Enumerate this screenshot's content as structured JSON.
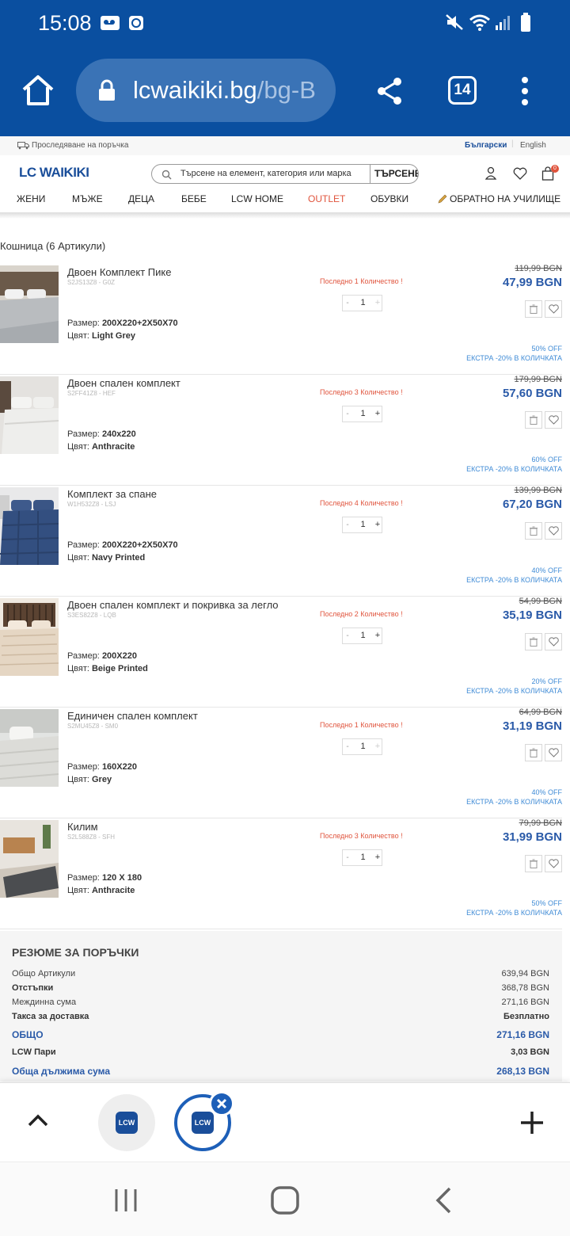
{
  "status_bar": {
    "time": "15:08"
  },
  "browser": {
    "url_host": "lcwaikiki.bg",
    "url_path": "/bg-B",
    "tab_count": "14"
  },
  "site_header": {
    "order_tracking": "Проследяване на поръчка",
    "lang_bg": "Български",
    "lang_en": "English",
    "logo": "LC WAIKIKI",
    "search_placeholder": "Търсене на елемент, категория или марка",
    "search_button": "ТЪРСЕНЕ",
    "cart_badge": "0",
    "nav": [
      "ЖЕНИ",
      "МЪЖЕ",
      "ДЕЦА",
      "БЕБЕ",
      "LCW HOME",
      "OUTLET",
      "ОБУВКИ",
      "ОБРАТНО НА УЧИЛИЩЕ"
    ]
  },
  "cart": {
    "title": "Кошница (6 Артикули)",
    "size_label": "Размер:",
    "color_label": "Цвят:",
    "items": [
      {
        "name": "Двоен Комплект Пике",
        "sku": "S2JS13Z8 - G0Z",
        "size": "200X220+2X50X70",
        "color": "Light Grey",
        "stock_note": "Последно 1 Количество !",
        "qty": "1",
        "old_price": "119,99 BGN",
        "price": "47,99 BGN",
        "discount": "50% OFF",
        "extra": "ЕКСТРА -20% В КОЛИЧКАТА"
      },
      {
        "name": "Двоен спален комплект",
        "sku": "S2FF41Z8 - HEF",
        "size": "240x220",
        "color": "Anthracite",
        "stock_note": "Последно 3 Количество !",
        "qty": "1",
        "old_price": "179,99 BGN",
        "price": "57,60 BGN",
        "discount": "60% OFF",
        "extra": "ЕКСТРА -20% В КОЛИЧКАТА"
      },
      {
        "name": "Комплект за спане",
        "sku": "W1H532Z8 - LSJ",
        "size": "200X220+2X50X70",
        "color": "Navy Printed",
        "stock_note": "Последно 4 Количество !",
        "qty": "1",
        "old_price": "139,99 BGN",
        "price": "67,20 BGN",
        "discount": "40% OFF",
        "extra": "ЕКСТРА -20% В КОЛИЧКАТА"
      },
      {
        "name": "Двоен спален комплект и покривка за легло",
        "sku": "S3ES82Z8 - LQB",
        "size": "200X220",
        "color": "Beige Printed",
        "stock_note": "Последно 2 Количество !",
        "qty": "1",
        "old_price": "54,99 BGN",
        "price": "35,19 BGN",
        "discount": "20% OFF",
        "extra": "ЕКСТРА -20% В КОЛИЧКАТА"
      },
      {
        "name": "Единичен спален комплект",
        "sku": "S2MU45Z8 - SM0",
        "size": "160X220",
        "color": "Grey",
        "stock_note": "Последно 1 Количество !",
        "qty": "1",
        "old_price": "64,99 BGN",
        "price": "31,19 BGN",
        "discount": "40% OFF",
        "extra": "ЕКСТРА -20% В КОЛИЧКАТА"
      },
      {
        "name": "Килим",
        "sku": "S2L588Z8 - SFH",
        "size": "120 X 180",
        "color": "Anthracite",
        "stock_note": "Последно 3 Количество !",
        "qty": "1",
        "old_price": "79,99 BGN",
        "price": "31,99 BGN",
        "discount": "50% OFF",
        "extra": "ЕКСТРА -20% В КОЛИЧКАТА"
      }
    ]
  },
  "summary": {
    "title": "РЕЗЮМЕ ЗА ПОРЪЧКИ",
    "rows": [
      {
        "label": "Общо Артикули",
        "value": "639,94 BGN"
      },
      {
        "label": "Отстъпки",
        "value": "368,78 BGN"
      },
      {
        "label": "Междинна сума",
        "value": "271,16 BGN"
      },
      {
        "label": "Такса за доставка",
        "value": "Безплатно"
      },
      {
        "label": "ОБЩО",
        "value": "271,16 BGN"
      },
      {
        "label": "LCW Пари",
        "value": "3,03 BGN"
      },
      {
        "label": "Обща дължима сума",
        "value": "268,13 BGN"
      }
    ]
  },
  "tab_bar": {
    "tab_label": "LCW"
  },
  "colors": {
    "primary": "#0a4fa0",
    "price_blue": "#2a5aa8",
    "discount_blue": "#3f8bd6",
    "alert_red": "#e0543d"
  }
}
